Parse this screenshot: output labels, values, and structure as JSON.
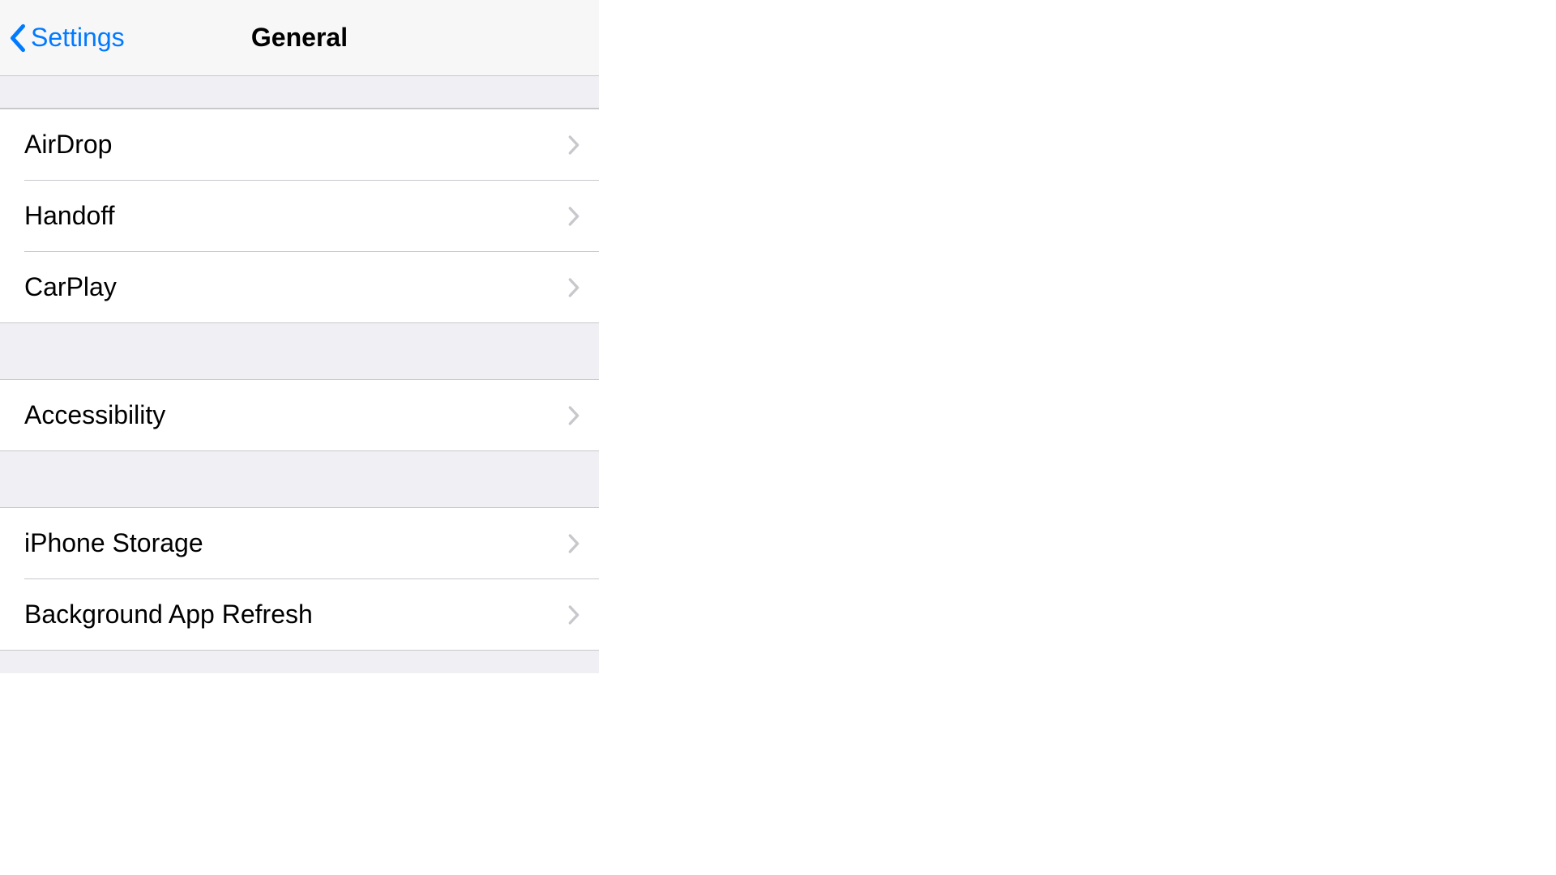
{
  "nav": {
    "back_label": "Settings",
    "title": "General"
  },
  "groups": [
    {
      "rows": [
        {
          "label": "AirDrop",
          "name": "row-airdrop"
        },
        {
          "label": "Handoff",
          "name": "row-handoff"
        },
        {
          "label": "CarPlay",
          "name": "row-carplay"
        }
      ]
    },
    {
      "rows": [
        {
          "label": "Accessibility",
          "name": "row-accessibility"
        }
      ]
    },
    {
      "rows": [
        {
          "label": "iPhone Storage",
          "name": "row-iphone-storage"
        },
        {
          "label": "Background App Refresh",
          "name": "row-background-app-refresh"
        }
      ]
    }
  ]
}
